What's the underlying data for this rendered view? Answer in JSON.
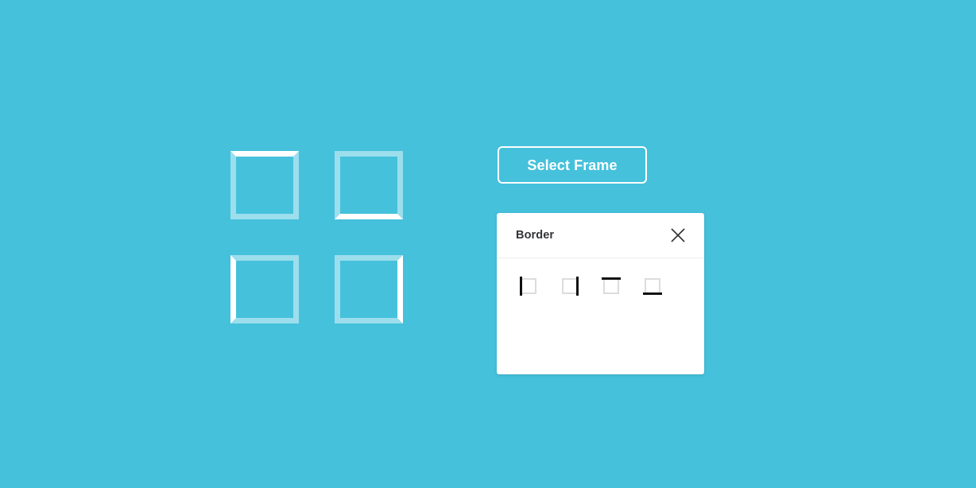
{
  "page": {
    "background_color": "#45c1dc",
    "accent_color": "#ffffff"
  },
  "canvas": {
    "frame_swatches": [
      {
        "id": "frame-swatch-top",
        "label": "Top border frame",
        "highlighted_edge": "top",
        "border_color": "#ffffff",
        "muted_border_color": "rgba(255,255,255,0.47)"
      },
      {
        "id": "frame-swatch-bottom",
        "label": "Bottom border frame",
        "highlighted_edge": "bottom",
        "border_color": "#ffffff",
        "muted_border_color": "rgba(255,255,255,0.47)"
      },
      {
        "id": "frame-swatch-left",
        "label": "Left border frame",
        "highlighted_edge": "left",
        "border_color": "#ffffff",
        "muted_border_color": "rgba(255,255,255,0.47)"
      },
      {
        "id": "frame-swatch-right",
        "label": "Right border frame",
        "highlighted_edge": "right",
        "border_color": "#ffffff",
        "muted_border_color": "rgba(255,255,255,0.47)"
      }
    ]
  },
  "toolbar": {
    "select_frame_label": "Select Frame"
  },
  "border_panel": {
    "title": "Border",
    "close_icon": "close-icon",
    "options": [
      {
        "icon": "border-left-icon",
        "edge": "left",
        "label": "Left border"
      },
      {
        "icon": "border-right-icon",
        "edge": "right",
        "label": "Right border"
      },
      {
        "icon": "border-top-icon",
        "edge": "top",
        "label": "Top border"
      },
      {
        "icon": "border-bottom-icon",
        "edge": "bottom",
        "label": "Bottom border"
      }
    ],
    "icon_outline_color": "#dcdcdc",
    "icon_active_color": "#111111"
  }
}
